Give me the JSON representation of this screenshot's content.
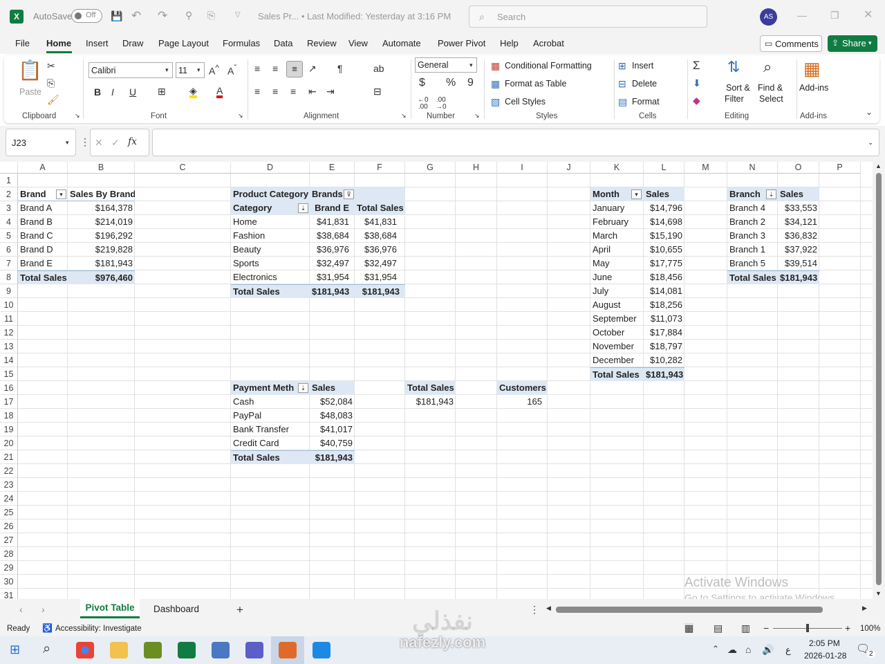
{
  "titlebar": {
    "autosave_label": "AutoSave",
    "autosave_state": "Off",
    "file_title": "Sales Pr... • Last Modified: Yesterday at 3:16 PM",
    "search_placeholder": "Search",
    "user_initials": "AS"
  },
  "menu_tabs": [
    "File",
    "Home",
    "Insert",
    "Draw",
    "Page Layout",
    "Formulas",
    "Data",
    "Review",
    "View",
    "Automate",
    "Power Pivot",
    "Help",
    "Acrobat"
  ],
  "comments_label": "Comments",
  "share_label": "Share",
  "ribbon": {
    "clipboard": {
      "label": "Clipboard",
      "paste": "Paste"
    },
    "font": {
      "label": "Font",
      "name": "Calibri",
      "size": "11"
    },
    "alignment": {
      "label": "Alignment"
    },
    "number": {
      "label": "Number",
      "format": "General"
    },
    "styles": {
      "label": "Styles",
      "conditional": "Conditional Formatting",
      "format_table": "Format as Table",
      "cell_styles": "Cell Styles"
    },
    "cells": {
      "label": "Cells",
      "insert": "Insert",
      "delete": "Delete",
      "format": "Format"
    },
    "editing": {
      "label": "Editing",
      "sort_filter_1": "Sort &",
      "sort_filter_2": "Filter",
      "find_select_1": "Find &",
      "find_select_2": "Select"
    },
    "addins": {
      "label": "Add-ins",
      "button": "Add-ins"
    }
  },
  "formula_bar": {
    "name_box": "J23",
    "fx": "fx",
    "formula": ""
  },
  "columns": [
    "A",
    "B",
    "C",
    "D",
    "E",
    "F",
    "G",
    "H",
    "I",
    "J",
    "K",
    "L",
    "M",
    "N",
    "O",
    "P"
  ],
  "rows": [
    "1",
    "2",
    "3",
    "4",
    "5",
    "6",
    "7",
    "8",
    "9",
    "10",
    "11",
    "12",
    "13",
    "14",
    "15",
    "16",
    "17",
    "18",
    "19",
    "20",
    "21",
    "22",
    "23",
    "24",
    "25",
    "26",
    "27",
    "28",
    "29",
    "30",
    "31"
  ],
  "pivot_brand": {
    "h1": "Brand",
    "h2": "Sales By Brand",
    "rows": [
      [
        "Brand A",
        "$164,378"
      ],
      [
        "Brand B",
        "$214,019"
      ],
      [
        "Brand C",
        "$196,292"
      ],
      [
        "Brand D",
        "$219,828"
      ],
      [
        "Brand E",
        "$181,943"
      ]
    ],
    "total": [
      "Total Sales",
      "$976,460"
    ]
  },
  "pivot_category": {
    "filter_label": "Product Category",
    "filter_value": "Brands",
    "h1": "Category",
    "h2": "Brand E",
    "h3": "Total Sales",
    "rows": [
      [
        "Home",
        "$41,831",
        "$41,831"
      ],
      [
        "Fashion",
        "$38,684",
        "$38,684"
      ],
      [
        "Beauty",
        "$36,976",
        "$36,976"
      ],
      [
        "Sports",
        "$32,497",
        "$32,497"
      ],
      [
        "Electronics",
        "$31,954",
        "$31,954"
      ]
    ],
    "total": [
      "Total Sales",
      "$181,943",
      "$181,943"
    ]
  },
  "pivot_payment": {
    "h1": "Payment Meth",
    "h2": "Sales",
    "rows": [
      [
        "Cash",
        "$52,084"
      ],
      [
        "PayPal",
        "$48,083"
      ],
      [
        "Bank Transfer",
        "$41,017"
      ],
      [
        "Credit Card",
        "$40,759"
      ]
    ],
    "total": [
      "Total Sales",
      "$181,943"
    ]
  },
  "kpi_total": {
    "label": "Total Sales",
    "value": "$181,943"
  },
  "kpi_customers": {
    "label": "Customers",
    "value": "165"
  },
  "pivot_month": {
    "h1": "Month",
    "h2": "Sales",
    "rows": [
      [
        "January",
        "$14,796"
      ],
      [
        "February",
        "$14,698"
      ],
      [
        "March",
        "$15,190"
      ],
      [
        "April",
        "$10,655"
      ],
      [
        "May",
        "$17,775"
      ],
      [
        "June",
        "$18,456"
      ],
      [
        "July",
        "$14,081"
      ],
      [
        "August",
        "$18,256"
      ],
      [
        "September",
        "$11,073"
      ],
      [
        "October",
        "$17,884"
      ],
      [
        "November",
        "$18,797"
      ],
      [
        "December",
        "$10,282"
      ]
    ],
    "total": [
      "Total Sales",
      "$181,943"
    ]
  },
  "pivot_branch": {
    "h1": "Branch",
    "h2": "Sales",
    "rows": [
      [
        "Branch 4",
        "$33,553"
      ],
      [
        "Branch 2",
        "$34,121"
      ],
      [
        "Branch 3",
        "$36,832"
      ],
      [
        "Branch 1",
        "$37,922"
      ],
      [
        "Branch 5",
        "$39,514"
      ]
    ],
    "total": [
      "Total Sales",
      "$181,943"
    ]
  },
  "watermark": {
    "line1": "Activate Windows",
    "line2": "Go to Settings to activate Windows."
  },
  "sheet_tabs": [
    "Pivot Table",
    "Dashboard"
  ],
  "active_sheet": "Pivot Table",
  "status": {
    "ready": "Ready",
    "accessibility": "Accessibility: Investigate",
    "zoom": "100%"
  },
  "taskbar": {
    "time": "2:05 PM",
    "date": "2026-01-28",
    "lang": "ع",
    "notif_count": "2"
  },
  "overlay_brand": {
    "arabic": "نفذلي",
    "latin": "nafezly.com"
  }
}
